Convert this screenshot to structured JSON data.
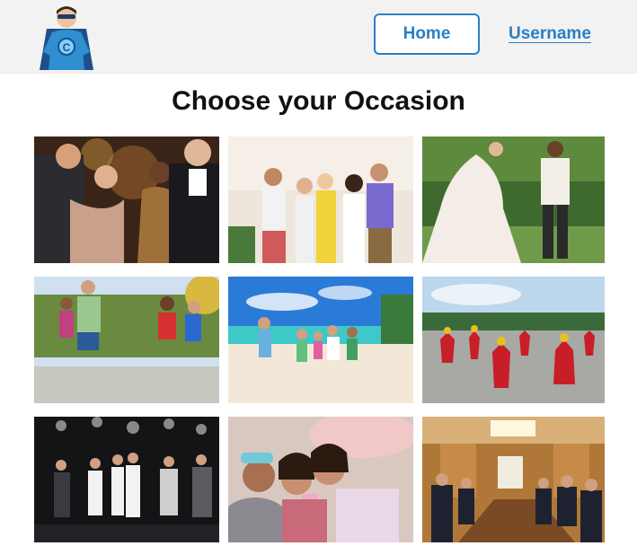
{
  "header": {
    "logo_icon": "superhero-mascot-icon",
    "home_label": "Home",
    "username_label": "Username"
  },
  "page": {
    "title": "Choose your Occasion"
  },
  "occasions": [
    {
      "icon": "party-toast-photo"
    },
    {
      "icon": "friends-celebrating-photo"
    },
    {
      "icon": "wedding-couple-photo"
    },
    {
      "icon": "group-running-photo"
    },
    {
      "icon": "family-beach-photo"
    },
    {
      "icon": "traditional-dance-photo"
    },
    {
      "icon": "nightclub-dancing-photo"
    },
    {
      "icon": "sleepover-selfie-photo"
    },
    {
      "icon": "business-meeting-photo"
    }
  ],
  "colors": {
    "accent": "#2a7fc4",
    "header_bg": "#f2f2f2"
  }
}
